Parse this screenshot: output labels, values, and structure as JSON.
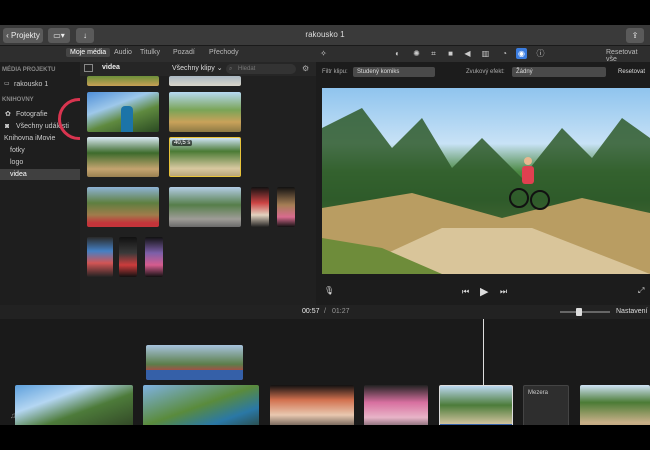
{
  "toolbar": {
    "projects_label": "Projekty",
    "project_title": "rakousko 1"
  },
  "browser_tabs": [
    "Moje média",
    "Audio",
    "Titulky",
    "Pozadí",
    "Přechody"
  ],
  "right_header": {
    "reset_all_label": "Resetovat vše"
  },
  "sidebar": {
    "header_project": "MÉDIA PROJEKTU",
    "project_item": "rakousko 1",
    "header_libraries": "KNIHOVNY",
    "items": [
      "Fotografie",
      "Všechny události",
      "Knihovna iMovie",
      "fotky",
      "logo",
      "videa"
    ]
  },
  "browser": {
    "folder_title": "videa",
    "filter_select": "Všechny klipy",
    "search_placeholder": "Hledat",
    "duration_badge": "40,5 s"
  },
  "viewer_settings": {
    "clip_filter_label": "Filtr klipu:",
    "clip_filter_value": "Studený komiks",
    "audio_effect_label": "Zvukový efekt:",
    "audio_effect_value": "Žádný",
    "reset_label": "Resetovat"
  },
  "timeline": {
    "current_time": "00:57",
    "separator": "/",
    "total_time": "01:27",
    "settings_label": "Nastavení",
    "gap_label": "Mezera"
  },
  "icons": {
    "back": "chevron-left-icon",
    "import": "download-icon",
    "share": "share-icon",
    "play": "play-icon",
    "mic": "microphone-icon",
    "fullscreen": "expand-icon"
  },
  "colors": {
    "accent": "#3b7de0",
    "selection": "#e8c33a",
    "audio_wave": "#3560a8",
    "cursor_highlight": "#d8344f"
  }
}
